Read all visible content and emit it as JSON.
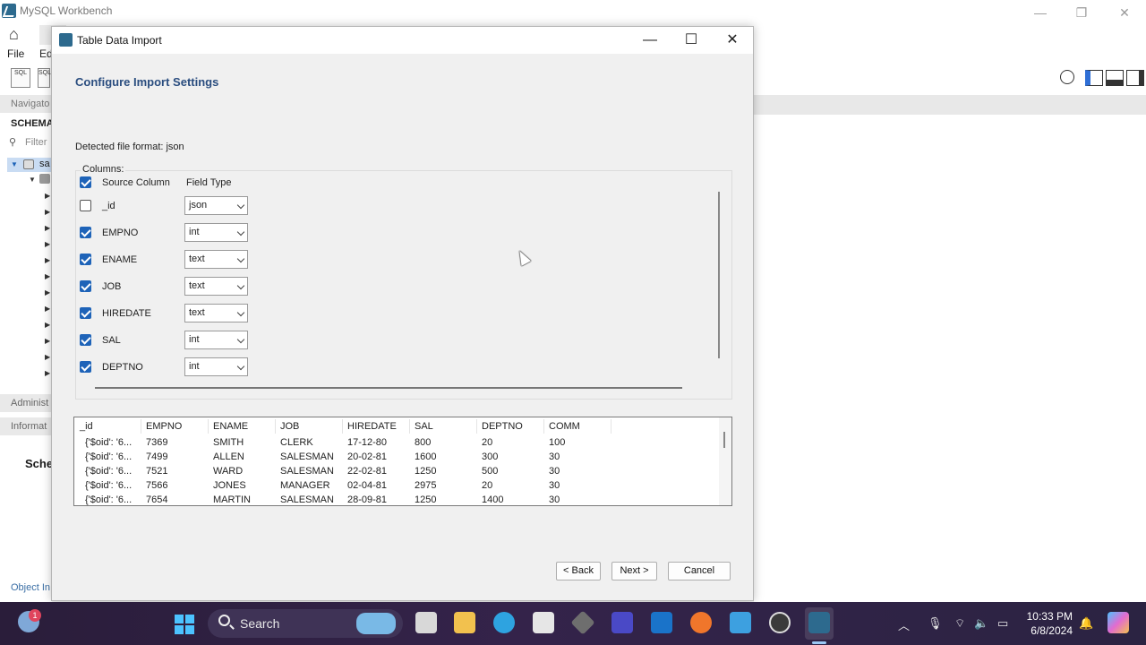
{
  "workbench": {
    "title": "MySQL Workbench",
    "menu": [
      "File",
      "Ed"
    ],
    "toolbar_labels": [
      "SQL",
      "SQL"
    ],
    "navigator_label": "Navigato",
    "schemas_label": "SCHEMA",
    "filter_placeholder": "Filter",
    "tree_item": "sa",
    "admin_tab": "Administ",
    "info_tab": "Informat",
    "schema_label": "Sche",
    "object_info": "Object In"
  },
  "dialog": {
    "title": "Table Data Import",
    "heading": "Configure Import Settings",
    "detected_format": "Detected file format: json",
    "columns_label": "Columns:",
    "header_source": "Source Column",
    "header_type": "Field Type",
    "columns": [
      {
        "name": "_id",
        "type": "json",
        "checked": false
      },
      {
        "name": "EMPNO",
        "type": "int",
        "checked": true
      },
      {
        "name": "ENAME",
        "type": "text",
        "checked": true
      },
      {
        "name": "JOB",
        "type": "text",
        "checked": true
      },
      {
        "name": "HIREDATE",
        "type": "text",
        "checked": true
      },
      {
        "name": "SAL",
        "type": "int",
        "checked": true
      },
      {
        "name": "DEPTNO",
        "type": "int",
        "checked": true
      }
    ],
    "preview": {
      "headers": [
        "_id",
        "EMPNO",
        "ENAME",
        "JOB",
        "HIREDATE",
        "SAL",
        "DEPTNO",
        "COMM"
      ],
      "rows": [
        [
          "{'$oid': '6...",
          "7369",
          "SMITH",
          "CLERK",
          "17-12-80",
          "800",
          "20",
          "100"
        ],
        [
          "{'$oid': '6...",
          "7499",
          "ALLEN",
          "SALESMAN",
          "20-02-81",
          "1600",
          "300",
          "30"
        ],
        [
          "{'$oid': '6...",
          "7521",
          "WARD",
          "SALESMAN",
          "22-02-81",
          "1250",
          "500",
          "30"
        ],
        [
          "{'$oid': '6...",
          "7566",
          "JONES",
          "MANAGER",
          "02-04-81",
          "2975",
          "20",
          "30"
        ],
        [
          "{'$oid': '6...",
          "7654",
          "MARTIN",
          "SALESMAN",
          "28-09-81",
          "1250",
          "1400",
          "30"
        ]
      ]
    },
    "buttons": {
      "back": "< Back",
      "next": "Next >",
      "cancel": "Cancel"
    }
  },
  "taskbar": {
    "search_label": "Search",
    "notification_count": "1",
    "time": "10:33 PM",
    "date": "6/8/2024"
  },
  "colors": {
    "checkbox": "#1e63b8",
    "heading": "#2a4d7f",
    "taskbar": "#2a1d3a"
  }
}
